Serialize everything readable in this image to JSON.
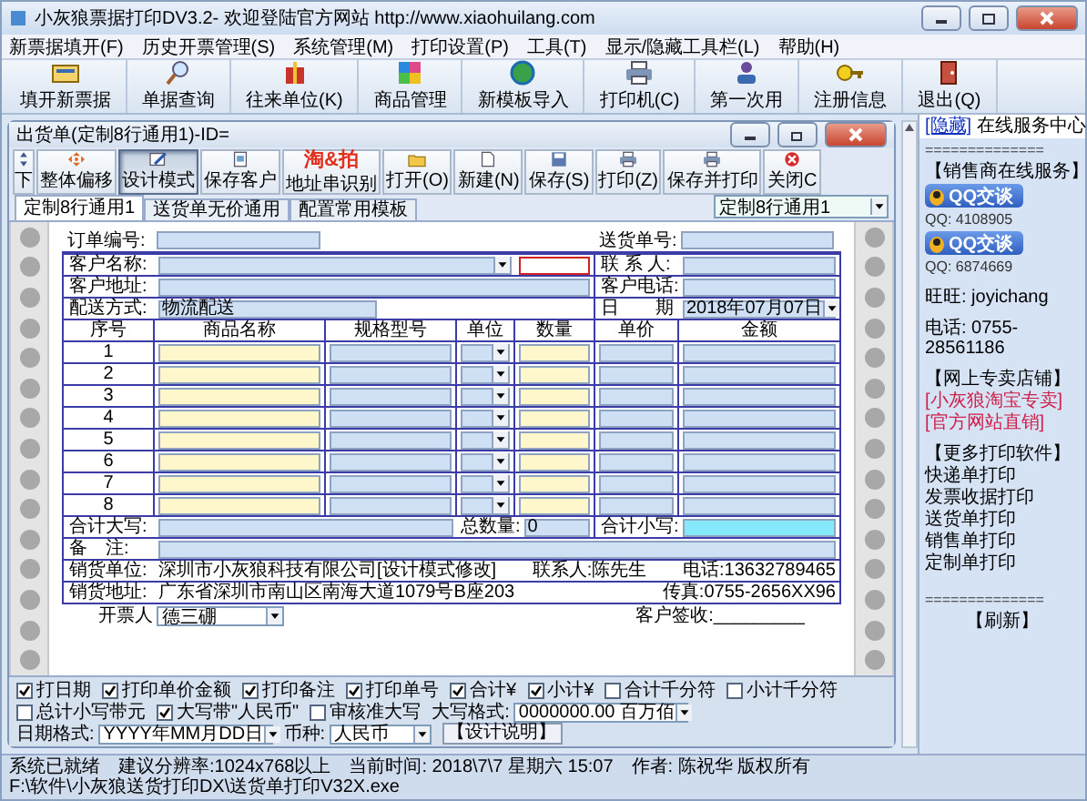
{
  "window": {
    "title": "小灰狼票据打印DV3.2- 欢迎登陆官方网站 http://www.xiaohuilang.com"
  },
  "menu": [
    "新票据填开(F)",
    "历史开票管理(S)",
    "系统管理(M)",
    "打印设置(P)",
    "工具(T)",
    "显示/隐藏工具栏(L)",
    "帮助(H)"
  ],
  "toolbar": [
    {
      "label": "填开新票据",
      "kind": "ticket"
    },
    {
      "label": "单据查询",
      "kind": "search"
    },
    {
      "label": "往来单位(K)",
      "kind": "gift"
    },
    {
      "label": "商品管理",
      "kind": "grid"
    },
    {
      "label": "新模板导入",
      "kind": "globe"
    },
    {
      "label": "打印机(C)",
      "kind": "printer"
    },
    {
      "label": "第一次用",
      "kind": "user"
    },
    {
      "label": "注册信息",
      "kind": "key"
    },
    {
      "label": "退出(Q)",
      "kind": "exit"
    }
  ],
  "document": {
    "title": "出货单(定制8行通用1)-ID=",
    "tools": [
      {
        "label": "下",
        "kind": "nudge",
        "pressed": false
      },
      {
        "label": "整体偏移",
        "kind": "move",
        "pressed": false
      },
      {
        "label": "设计模式",
        "kind": "design",
        "pressed": true
      },
      {
        "label": "保存客户",
        "kind": "save-customer",
        "pressed": false
      },
      {
        "label": "地址串识别",
        "kind": "taobao",
        "logo": "淘&拍",
        "pressed": false
      },
      {
        "label": "打开(O)",
        "kind": "open",
        "pressed": false
      },
      {
        "label": "新建(N)",
        "kind": "new",
        "pressed": false
      },
      {
        "label": "保存(S)",
        "kind": "save",
        "pressed": false
      },
      {
        "label": "打印(Z)",
        "kind": "print",
        "pressed": false
      },
      {
        "label": "保存并打印",
        "kind": "print",
        "pressed": false
      },
      {
        "label": "关闭C",
        "kind": "close",
        "pressed": false
      }
    ],
    "tabs": [
      {
        "label": "定制8行通用1",
        "selected": true
      },
      {
        "label": "送货单无价通用",
        "selected": false
      },
      {
        "label": "配置常用模板",
        "selected": false
      }
    ],
    "template_select": "定制8行通用1"
  },
  "form": {
    "order_no": "订单编号:",
    "delivery_no": "送货单号:",
    "customer_name": "客户名称:",
    "customer_code": {
      "focused": true
    },
    "contact": "联 系 人:",
    "customer_address": "客户地址:",
    "customer_phone": "客户电话:",
    "delivery": "配送方式:",
    "delivery_value": "物流配送",
    "date": "日　　期",
    "date_value": "2018年07月07日",
    "columns": [
      "序号",
      "商品名称",
      "规格型号",
      "单位",
      "数量",
      "单价",
      "金额"
    ],
    "rows": [
      "1",
      "2",
      "3",
      "4",
      "5",
      "6",
      "7",
      "8"
    ],
    "total_upper": "合计大写:",
    "total_qty": "总数量:",
    "total_qty_value": "0",
    "total_lower": "合计小写:",
    "notes": "备　注:",
    "seller": "销货单位:",
    "seller_value": "深圳市小灰狼科技有限公司[设计模式修改]",
    "seller_contact": "联系人:陈先生",
    "seller_phone": "电话:13632789465",
    "seller_address": "销货地址:",
    "seller_address_value": "广东省深圳市南山区南海大道1079号B座203",
    "seller_fax": "传真:0755-2656XX96",
    "issuer": "开票人",
    "issuer_value": "德三硼",
    "signature": "客户签收:_________"
  },
  "options": [
    {
      "label": "打日期",
      "checked": true
    },
    {
      "label": "打印单价金额",
      "checked": true
    },
    {
      "label": "打印备注",
      "checked": true
    },
    {
      "label": "打印单号",
      "checked": true
    },
    {
      "label": "合计¥",
      "checked": true
    },
    {
      "label": "小计¥",
      "checked": true
    },
    {
      "label": "合计千分符",
      "checked": false
    },
    {
      "label": "小计千分符",
      "checked": false
    },
    {
      "label": "总计小写带元",
      "checked": false
    },
    {
      "label": "大写带\"人民币\"",
      "checked": true
    },
    {
      "label": "审核准大写",
      "checked": false
    }
  ],
  "formats": [
    {
      "label": "大写格式:",
      "value": "0000000.00 百万佰"
    },
    {
      "label": "日期格式:",
      "value": "YYYY年MM月DD日"
    },
    {
      "label": "币种:",
      "value": "人民币"
    }
  ],
  "design_help": "【设计说明】",
  "side": {
    "hide": "[隐藏]",
    "title": "在线服务中心",
    "rule": "==============",
    "sales_heading": "【销售商在线服务】",
    "qq": [
      {
        "button": "QQ交谈",
        "number": "QQ: 4108905"
      },
      {
        "button": "QQ交谈",
        "number": "QQ: 6874669"
      }
    ],
    "wangwang": "旺旺: joyichang",
    "phone": "电话: 0755-28561186",
    "shop_heading": "【网上专卖店铺】",
    "shop_links": [
      "[小灰狼淘宝专卖]",
      "[官方网站直销]"
    ],
    "more_heading": "【更多打印软件】",
    "more": [
      "快递单打印",
      "发票收据打印",
      "送货单打印",
      "销售单打印",
      "定制单打印"
    ],
    "rule2": "==============",
    "refresh": "【刷新】"
  },
  "status_bar": [
    "系统已就绪",
    "建议分辨率:1024x768以上",
    "当前时间: 2018\\7\\7 星期六 15:07",
    "作者: 陈祝华 版权所有",
    "F:\\软件\\小灰狼送货打印DX\\送货单打印V32X.exe"
  ]
}
